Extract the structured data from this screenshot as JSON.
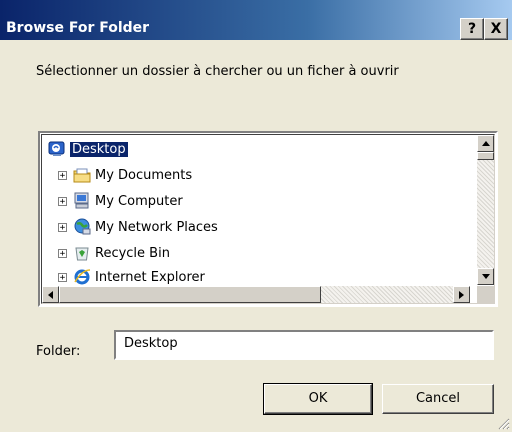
{
  "dialog": {
    "title": "Browse For Folder",
    "help_glyph": "?",
    "close_glyph": "X"
  },
  "prompt": "Sélectionner un dossier à chercher ou un ficher à ouvrir",
  "tree": {
    "items": [
      {
        "label": "Desktop",
        "icon": "desktop-icon",
        "selected": true
      },
      {
        "label": "My Documents",
        "icon": "my-documents-icon",
        "expander": "+"
      },
      {
        "label": "My Computer",
        "icon": "my-computer-icon",
        "expander": "+"
      },
      {
        "label": "My Network Places",
        "icon": "network-places-icon",
        "expander": "+"
      },
      {
        "label": "Recycle Bin",
        "icon": "recycle-bin-icon",
        "expander": "+"
      },
      {
        "label": "Internet Explorer",
        "icon": "internet-explorer-icon",
        "expander": "+"
      }
    ]
  },
  "folder": {
    "label": "Folder:",
    "value": "Desktop"
  },
  "buttons": {
    "ok": "OK",
    "cancel": "Cancel"
  },
  "colors": {
    "titlebar": "#0a246a",
    "selection": "#0a246a",
    "face": "#ece9d8"
  }
}
